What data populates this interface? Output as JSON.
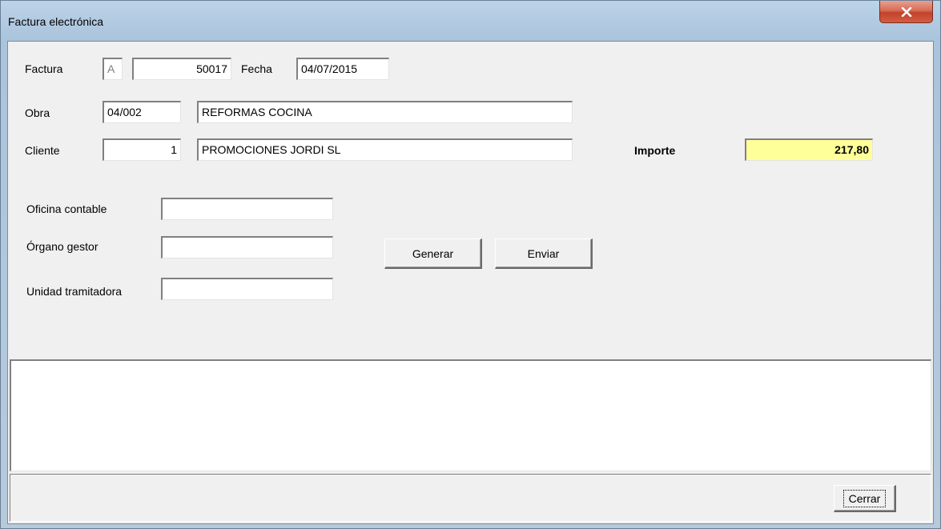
{
  "window": {
    "title": "Factura electrónica",
    "close_glyph": "X"
  },
  "invoice": {
    "factura_label": "Factura",
    "series": "A",
    "number": "50017",
    "fecha_label": "Fecha",
    "fecha": "04/07/2015"
  },
  "obra": {
    "label": "Obra",
    "code": "04/002",
    "name": "REFORMAS COCINA"
  },
  "cliente": {
    "label": "Cliente",
    "code": "1",
    "name": "PROMOCIONES JORDI SL"
  },
  "importe": {
    "label": "Importe",
    "value": "217,80",
    "highlight_color": "#ffff99"
  },
  "face": {
    "oficina_label": "Oficina contable",
    "oficina_value": "",
    "organo_label": "Órgano gestor",
    "organo_value": "",
    "unidad_label": "Unidad tramitadora",
    "unidad_value": ""
  },
  "actions": {
    "generar": "Generar",
    "enviar": "Enviar"
  },
  "footer": {
    "cerrar": "Cerrar"
  }
}
